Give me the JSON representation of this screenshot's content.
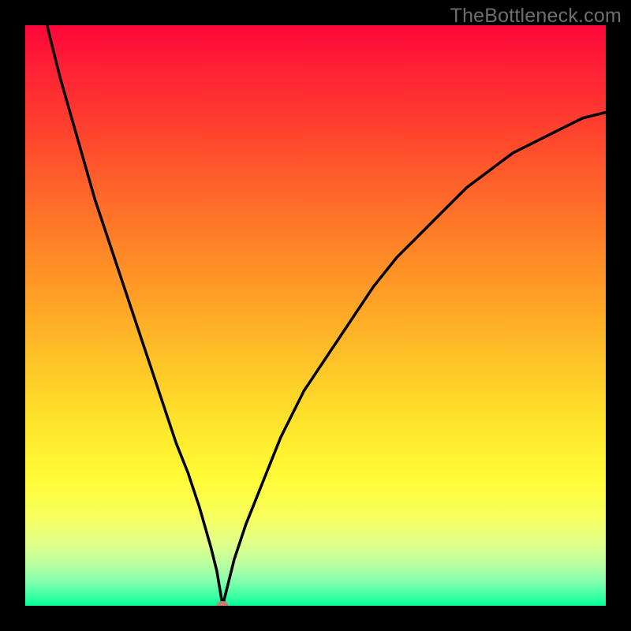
{
  "watermark": "TheBottleneck.com",
  "chart_data": {
    "type": "line",
    "title": "",
    "xlabel": "",
    "ylabel": "",
    "xlim": [
      0,
      100
    ],
    "ylim": [
      0,
      100
    ],
    "marker": {
      "x": 34,
      "y": 0,
      "color": "#c97e74"
    },
    "background_gradient": {
      "top": "#ff063a",
      "bottom": "#00ff94"
    },
    "series": [
      {
        "name": "bottleneck-curve",
        "x": [
          0,
          2,
          4,
          6,
          8,
          10,
          12,
          14,
          16,
          18,
          20,
          22,
          24,
          26,
          28,
          30,
          32,
          33,
          34,
          35,
          36,
          38,
          40,
          44,
          48,
          52,
          56,
          60,
          64,
          68,
          72,
          76,
          80,
          84,
          88,
          92,
          96,
          100
        ],
        "y": [
          120,
          108,
          99,
          91,
          84,
          77,
          70,
          64,
          58,
          52,
          46,
          40,
          34,
          28,
          23,
          17,
          10,
          6,
          0,
          4,
          8,
          14,
          19,
          29,
          37,
          43,
          49,
          55,
          60,
          64,
          68,
          72,
          75,
          78,
          80,
          82,
          84,
          85
        ]
      }
    ]
  }
}
